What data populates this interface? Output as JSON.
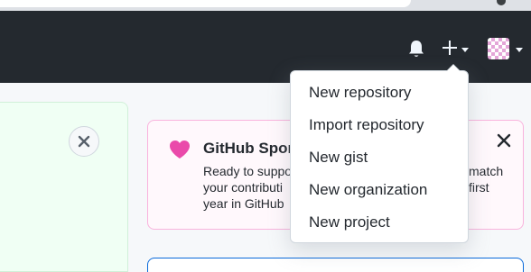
{
  "icons": {
    "notifications": "bell-icon",
    "create": "plus-icon",
    "dismiss": "x-icon",
    "sponsor": "heart-icon"
  },
  "colors": {
    "header_bg": "#24292f",
    "heart": "#ea4aaa",
    "sponsor_border": "#f9b3dd",
    "link_blue": "#0969da"
  },
  "create_menu": {
    "items": [
      {
        "label": "New repository"
      },
      {
        "label": "Import repository"
      },
      {
        "label": "New gist"
      },
      {
        "label": "New organization"
      },
      {
        "label": "New project"
      }
    ]
  },
  "sponsor_card": {
    "title": "GitHub Spor",
    "desc_left": [
      "Ready to suppo",
      "your contributi",
      "year in GitHub"
    ],
    "desc_right": [
      "match",
      "first"
    ]
  }
}
